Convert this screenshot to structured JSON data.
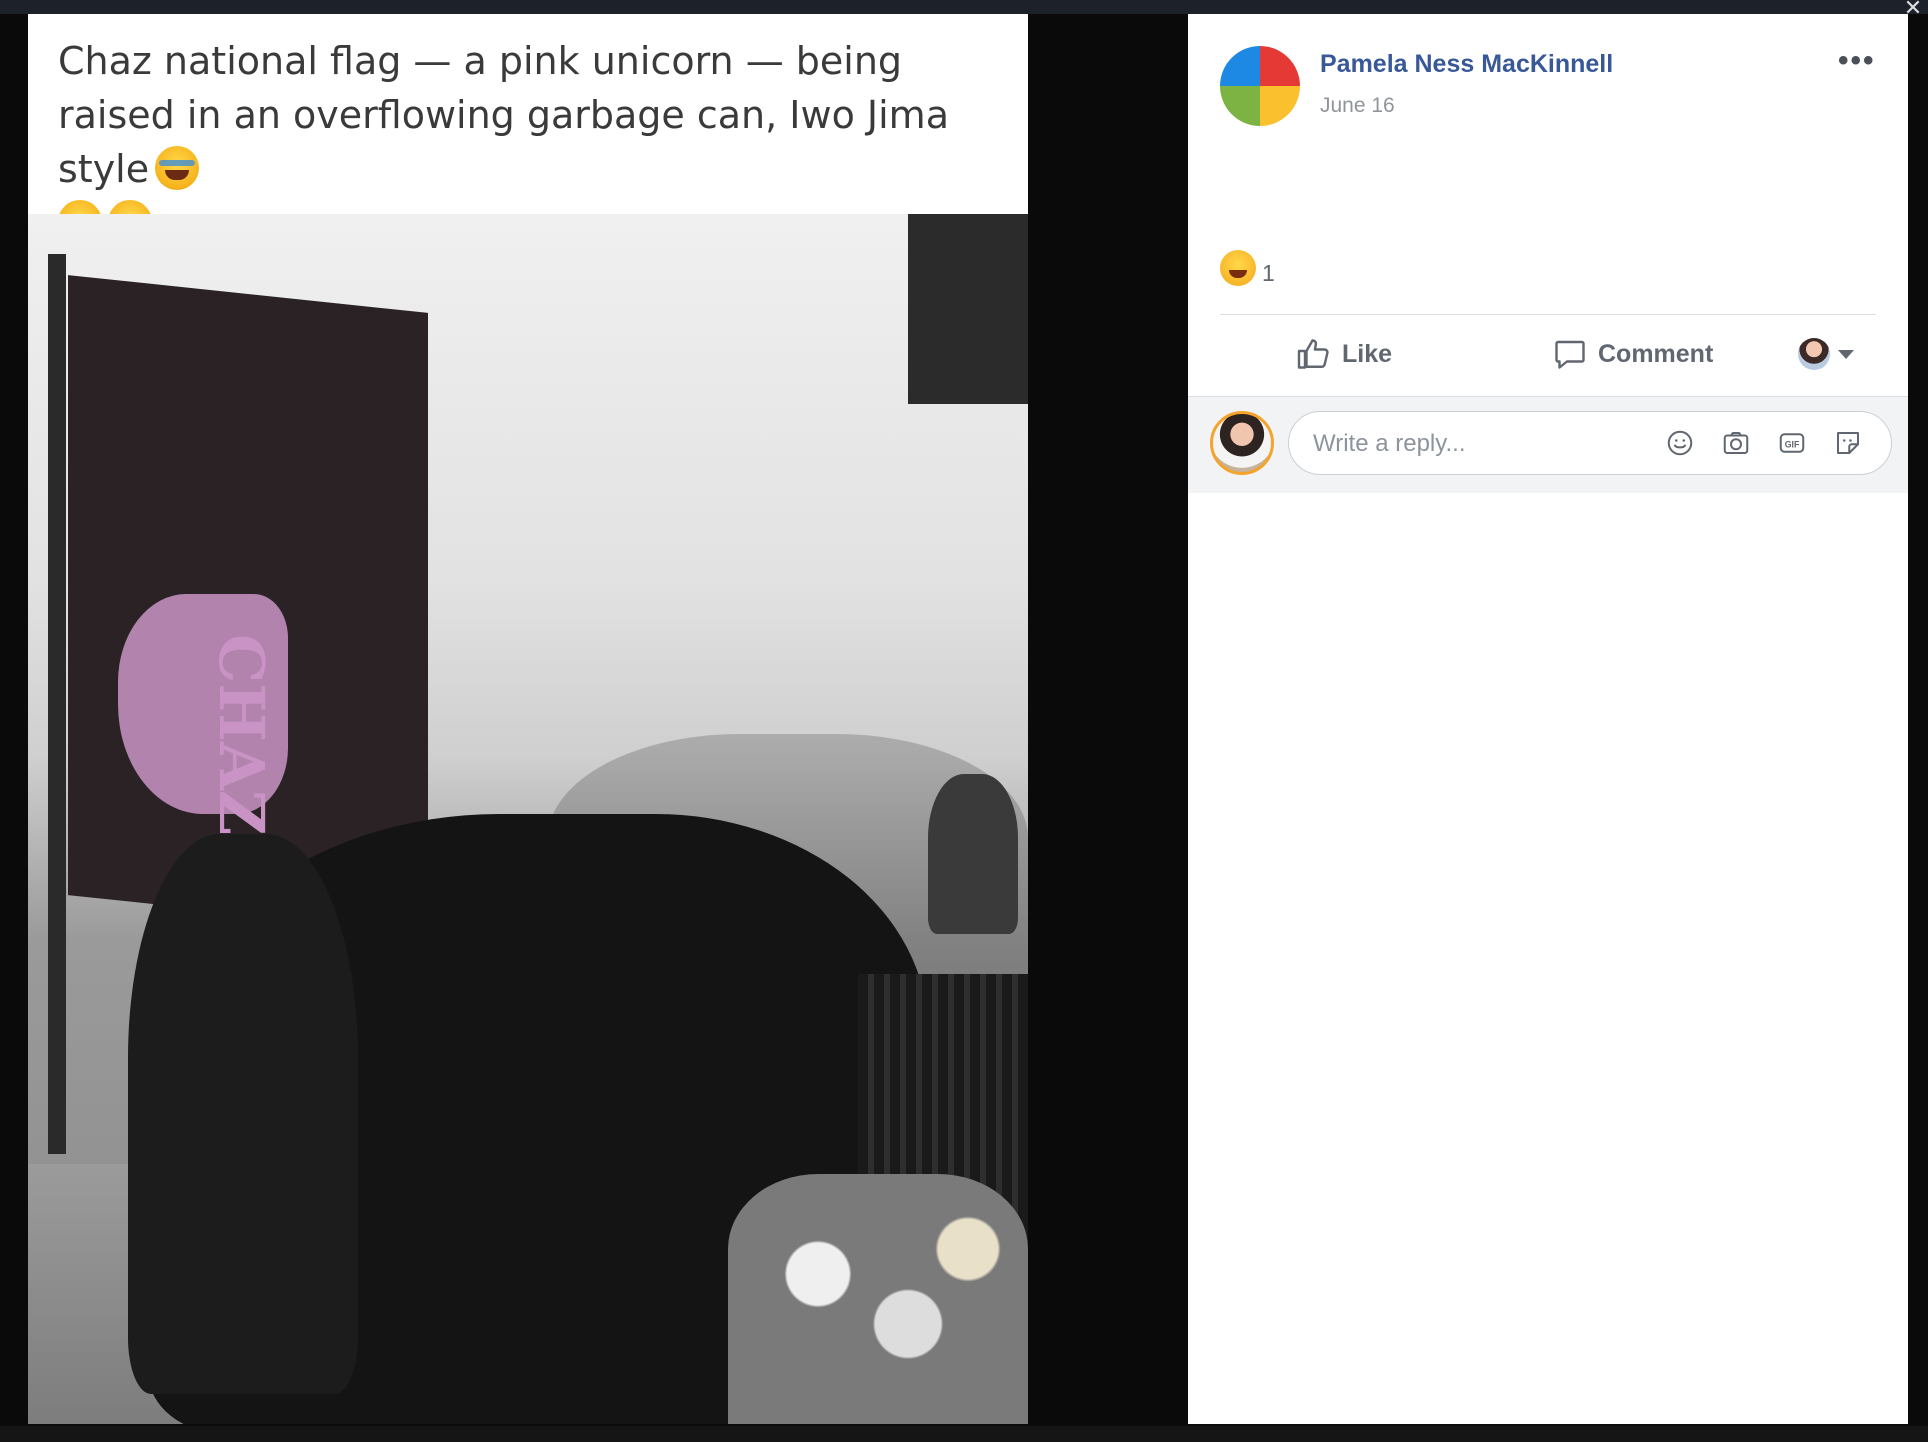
{
  "post_image": {
    "caption": "Chaz national flag — a pink unicorn — being raised in an overflowing garbage can, Iwo Jima style",
    "caption_emoji": [
      "rolling-on-floor-laughing-emoji",
      "rolling-on-floor-laughing-emoji",
      "rolling-on-floor-laughing-emoji"
    ],
    "flag_text": "CHAZ"
  },
  "post": {
    "author": "Pamela Ness MacKinnell",
    "date": "June 16",
    "more_label": "•••",
    "reaction_icon": "haha-reaction-icon",
    "reaction_count": "1"
  },
  "actions": {
    "like": "Like",
    "comment": "Comment"
  },
  "reply": {
    "placeholder": "Write a reply..."
  },
  "colors": {
    "author_link": "#385898",
    "muted_text": "#606770",
    "panel_bg": "#ffffff",
    "backdrop": "#0a0a0a"
  }
}
